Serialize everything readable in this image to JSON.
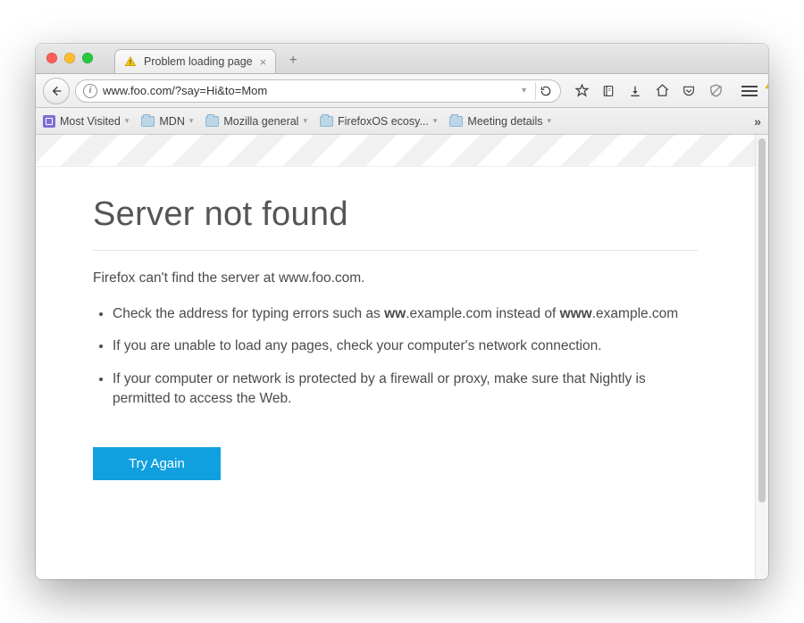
{
  "tab": {
    "title": "Problem loading page"
  },
  "url": "www.foo.com/?say=Hi&to=Mom",
  "bookmarks": {
    "items": [
      {
        "label": "Most Visited",
        "kind": "mv"
      },
      {
        "label": "MDN",
        "kind": "folder"
      },
      {
        "label": "Mozilla general",
        "kind": "folder"
      },
      {
        "label": "FirefoxOS ecosy...",
        "kind": "folder"
      },
      {
        "label": "Meeting details",
        "kind": "folder"
      }
    ]
  },
  "error": {
    "heading": "Server not found",
    "lead": "Firefox can't find the server at www.foo.com.",
    "bullets": {
      "b1_pre": "Check the address for typing errors such as ",
      "b1_bold1": "ww",
      "b1_mid": ".example.com instead of ",
      "b1_bold2": "www",
      "b1_post": ".example.com",
      "b2": "If you are unable to load any pages, check your computer's network connection.",
      "b3": "If your computer or network is protected by a firewall or proxy, make sure that Nightly is permitted to access the Web."
    },
    "try_again": "Try Again"
  }
}
